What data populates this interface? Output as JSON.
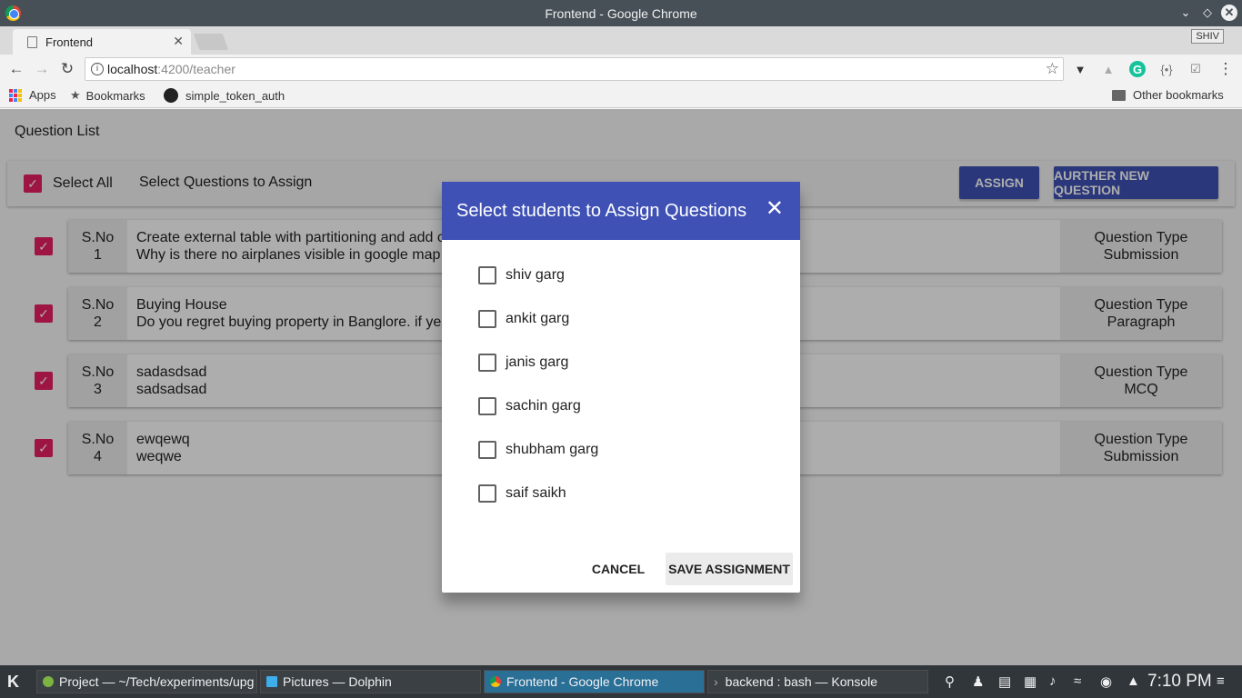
{
  "window": {
    "title": "Frontend - Google Chrome"
  },
  "browser": {
    "tab_title": "Frontend",
    "profile_badge": "SHIV",
    "url_host": "localhost",
    "url_path": ":4200/teacher",
    "bookmarks": [
      {
        "label": "Apps",
        "icon": "apps-grid-icon"
      },
      {
        "label": "Bookmarks",
        "icon": "star-icon"
      },
      {
        "label": "simple_token_auth",
        "icon": "github-icon"
      }
    ],
    "other_bookmarks": "Other bookmarks"
  },
  "page": {
    "title": "Question List",
    "select_all_label": "Select All",
    "toolbar_label": "Select Questions to Assign",
    "assign_button": "ASSIGN",
    "new_question_button": "AURTHER NEW QUESTION",
    "questions": [
      {
        "sno_label": "S.No",
        "sno": "1",
        "title": "Create external table with partitioning and add c",
        "body": "Why is there no airplanes visible in google map",
        "type_label": "Question Type",
        "type": "Submission",
        "checked": true
      },
      {
        "sno_label": "S.No",
        "sno": "2",
        "title": "Buying House",
        "body": "Do you regret buying property in Banglore. if yes",
        "type_label": "Question Type",
        "type": "Paragraph",
        "checked": true
      },
      {
        "sno_label": "S.No",
        "sno": "3",
        "title": "sadasdsad",
        "body": "sadsadsad",
        "type_label": "Question Type",
        "type": "MCQ",
        "checked": true
      },
      {
        "sno_label": "S.No",
        "sno": "4",
        "title": "ewqewq",
        "body": "weqwe",
        "type_label": "Question Type",
        "type": "Submission",
        "checked": true
      }
    ]
  },
  "dialog": {
    "title": "Select students to Assign Questions",
    "students": [
      {
        "name": "shiv garg",
        "checked": false
      },
      {
        "name": "ankit garg",
        "checked": false
      },
      {
        "name": "janis garg",
        "checked": false
      },
      {
        "name": "sachin garg",
        "checked": false
      },
      {
        "name": "shubham garg",
        "checked": false
      },
      {
        "name": "saif saikh",
        "checked": false
      }
    ],
    "cancel_button": "CANCEL",
    "save_button": "SAVE ASSIGNMENT"
  },
  "taskbar": {
    "tasks": [
      {
        "label": "Project — ~/Tech/experiments/upg",
        "active": false
      },
      {
        "label": "Pictures — Dolphin",
        "active": false
      },
      {
        "label": "Frontend - Google Chrome",
        "active": true
      },
      {
        "label": "backend : bash — Konsole",
        "active": false
      }
    ],
    "clock": "7:10 PM"
  },
  "colors": {
    "primary": "#3f51b5",
    "accent": "#e91e63"
  }
}
